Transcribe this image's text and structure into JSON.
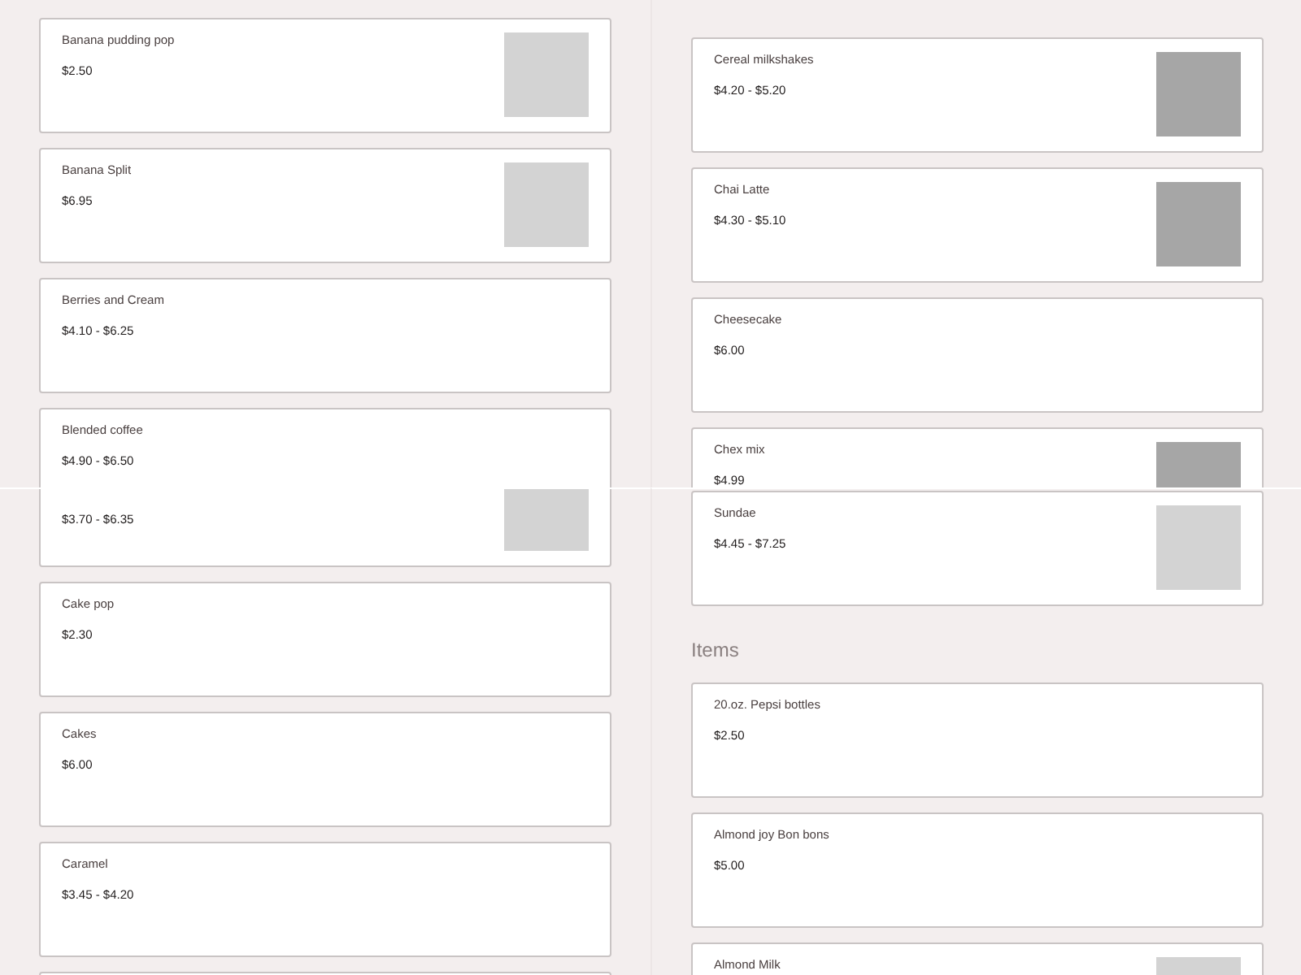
{
  "panels": [
    {
      "entries": [
        {
          "kind": "card",
          "name": "Banana pudding pop",
          "price": "$2.50",
          "color": "#d3d3d3"
        },
        {
          "kind": "card",
          "name": "Banana Split",
          "price": "$6.95",
          "color": "#d3d3d3"
        },
        {
          "kind": "card",
          "name": "Berries and Cream",
          "price": "$4.10 - $6.25"
        },
        {
          "kind": "card",
          "name": "Blended coffee",
          "price": "$4.90 - $6.50"
        }
      ]
    },
    {
      "entries": [
        {
          "kind": "card",
          "name": "Cereal milkshakes",
          "price": "$4.20 - $5.20",
          "color": "#a6a6a6"
        },
        {
          "kind": "card",
          "name": "Chai Latte",
          "price": "$4.30 - $5.10",
          "color": "#a6a6a6"
        },
        {
          "kind": "card",
          "name": "Cheesecake",
          "price": "$6.00"
        },
        {
          "kind": "card",
          "name": "Chex mix",
          "price": "$4.99",
          "color": "#a6a6a6"
        }
      ]
    },
    {
      "entries": [
        {
          "kind": "card",
          "price": "$3.70 - $6.35",
          "color": "#d3d3d3"
        },
        {
          "kind": "card",
          "name": "Cake pop",
          "price": "$2.30"
        },
        {
          "kind": "card",
          "name": "Cakes",
          "price": "$6.00"
        },
        {
          "kind": "card",
          "name": "Caramel",
          "price": "$3.45 - $4.20"
        },
        {
          "kind": "card"
        }
      ]
    },
    {
      "entries": [
        {
          "kind": "card",
          "name": "Sundae",
          "price": "$4.45 - $7.25",
          "color": "#d3d3d3"
        },
        {
          "kind": "heading",
          "text": "Items"
        },
        {
          "kind": "card",
          "name": "20.oz. Pepsi bottles",
          "price": "$2.50"
        },
        {
          "kind": "card",
          "name": "Almond joy Bon bons",
          "price": "$5.00"
        },
        {
          "kind": "card",
          "name": "Almond Milk",
          "color": "#d3d3d3"
        }
      ]
    }
  ]
}
